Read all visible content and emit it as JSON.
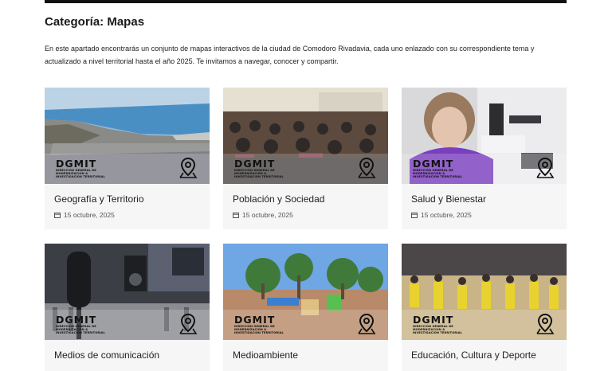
{
  "page": {
    "title": "Categoría: Mapas",
    "intro": "En este apartado encontrarás un conjunto de mapas interactivos de la ciudad de Comodoro Rivadavia, cada uno enlazado con su correspondiente tema y actualizado a nivel territorial hasta el año 2025. Te invitamos a navegar, conocer y compartir."
  },
  "watermark": {
    "logo_text": "DGMIT",
    "logo_subtext_1": "DIRECCIÓN GENERAL DE",
    "logo_subtext_2": "MODERNIZACIÓN &",
    "logo_subtext_3": "INVESTIGACIÓN TERRITORIAL",
    "pin_icon": "map-pin-icon"
  },
  "cards": [
    {
      "title": "Geografía y Territorio",
      "date": "15 octubre, 2025",
      "image": "coastal-city-aerial"
    },
    {
      "title": "Población y Sociedad",
      "date": "15 octubre, 2025",
      "image": "audience-in-hall"
    },
    {
      "title": "Salud y Bienestar",
      "date": "15 octubre, 2025",
      "image": "lab-microscope"
    },
    {
      "title": "Medios de comunicación",
      "date": "",
      "image": "radio-studio-microphone"
    },
    {
      "title": "Medioambiente",
      "date": "",
      "image": "park-playground"
    },
    {
      "title": "Educación, Cultura y Deporte",
      "date": "",
      "image": "sports-performance"
    }
  ],
  "colors": {
    "card_bg": "#f6f6f6",
    "topbar": "#111111"
  }
}
